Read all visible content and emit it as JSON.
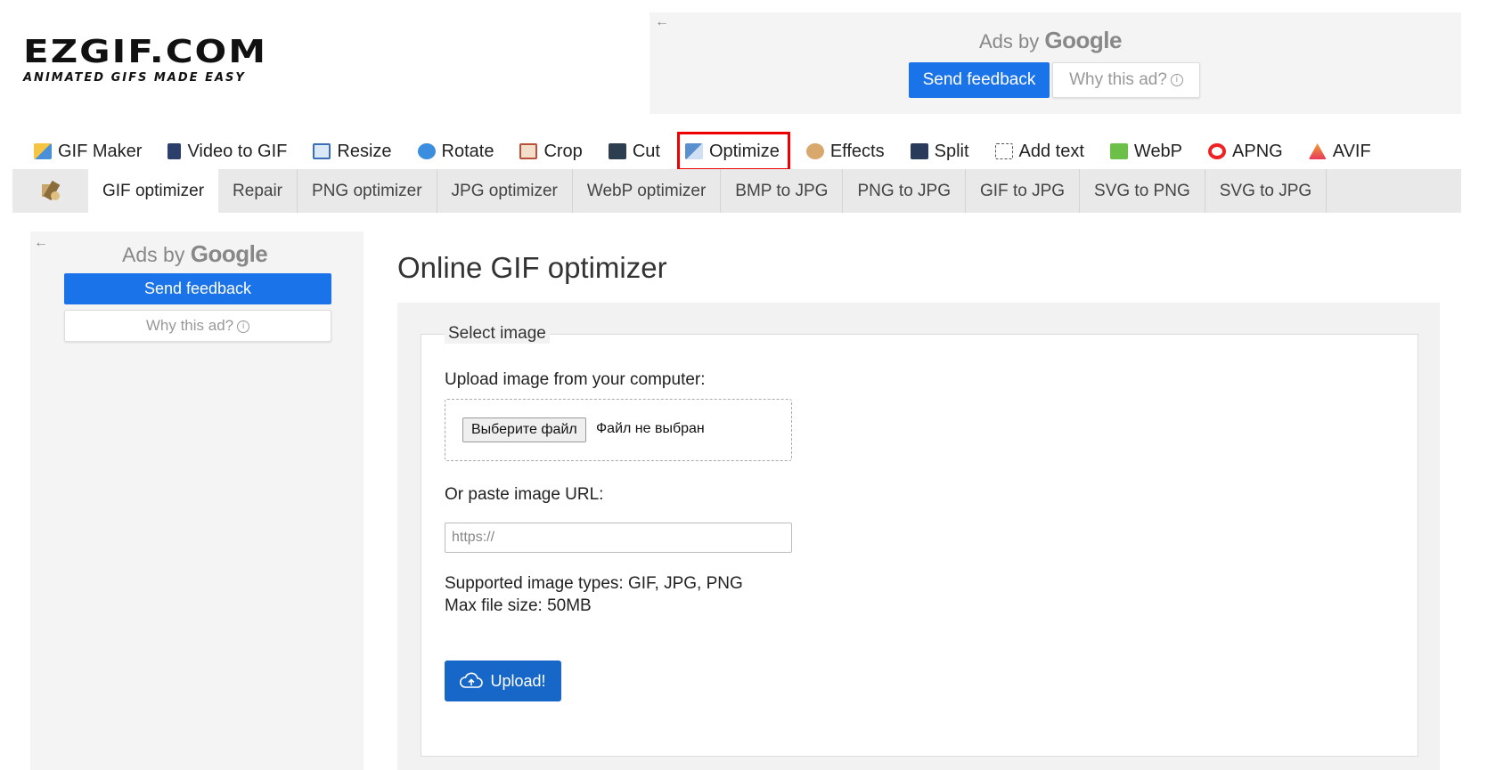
{
  "logo": {
    "title": "EZGIF.COM",
    "tagline": "ANIMATED GIFS MADE EASY"
  },
  "top_ad": {
    "ads_by": "Ads by",
    "google": "Google",
    "send_feedback": "Send feedback",
    "why_this_ad": "Why this ad?"
  },
  "main_nav": {
    "items": [
      {
        "label": "GIF Maker",
        "icon": "gif-maker-icon"
      },
      {
        "label": "Video to GIF",
        "icon": "film-icon"
      },
      {
        "label": "Resize",
        "icon": "resize-icon"
      },
      {
        "label": "Rotate",
        "icon": "rotate-icon"
      },
      {
        "label": "Crop",
        "icon": "crop-icon"
      },
      {
        "label": "Cut",
        "icon": "cut-icon"
      },
      {
        "label": "Optimize",
        "icon": "optimize-icon"
      },
      {
        "label": "Effects",
        "icon": "palette-icon"
      },
      {
        "label": "Split",
        "icon": "split-icon"
      },
      {
        "label": "Add text",
        "icon": "add-text-icon"
      },
      {
        "label": "WebP",
        "icon": "webp-icon"
      },
      {
        "label": "APNG",
        "icon": "apng-icon"
      },
      {
        "label": "AVIF",
        "icon": "avif-icon"
      }
    ],
    "active": "Optimize",
    "highlight_color": "#ee0000"
  },
  "sub_nav": {
    "items": [
      "GIF optimizer",
      "Repair",
      "PNG optimizer",
      "JPG optimizer",
      "WebP optimizer",
      "BMP to JPG",
      "PNG to JPG",
      "GIF to JPG",
      "SVG to PNG",
      "SVG to JPG"
    ],
    "active": "GIF optimizer"
  },
  "left_ad": {
    "ads_by": "Ads by",
    "google": "Google",
    "send_feedback": "Send feedback",
    "why_this_ad": "Why this ad?"
  },
  "main": {
    "title": "Online GIF optimizer",
    "fieldset_legend": "Select image",
    "upload_label": "Upload image from your computer:",
    "file_button": "Выберите файл",
    "file_status": "Файл не выбран",
    "url_label": "Or paste image URL:",
    "url_placeholder": "https://",
    "supported_types": "Supported image types: GIF, JPG, PNG",
    "max_size": "Max file size: 50MB",
    "upload_button": "Upload!"
  },
  "colors": {
    "accent_blue": "#1a73e8",
    "upload_blue": "#1767c8"
  }
}
